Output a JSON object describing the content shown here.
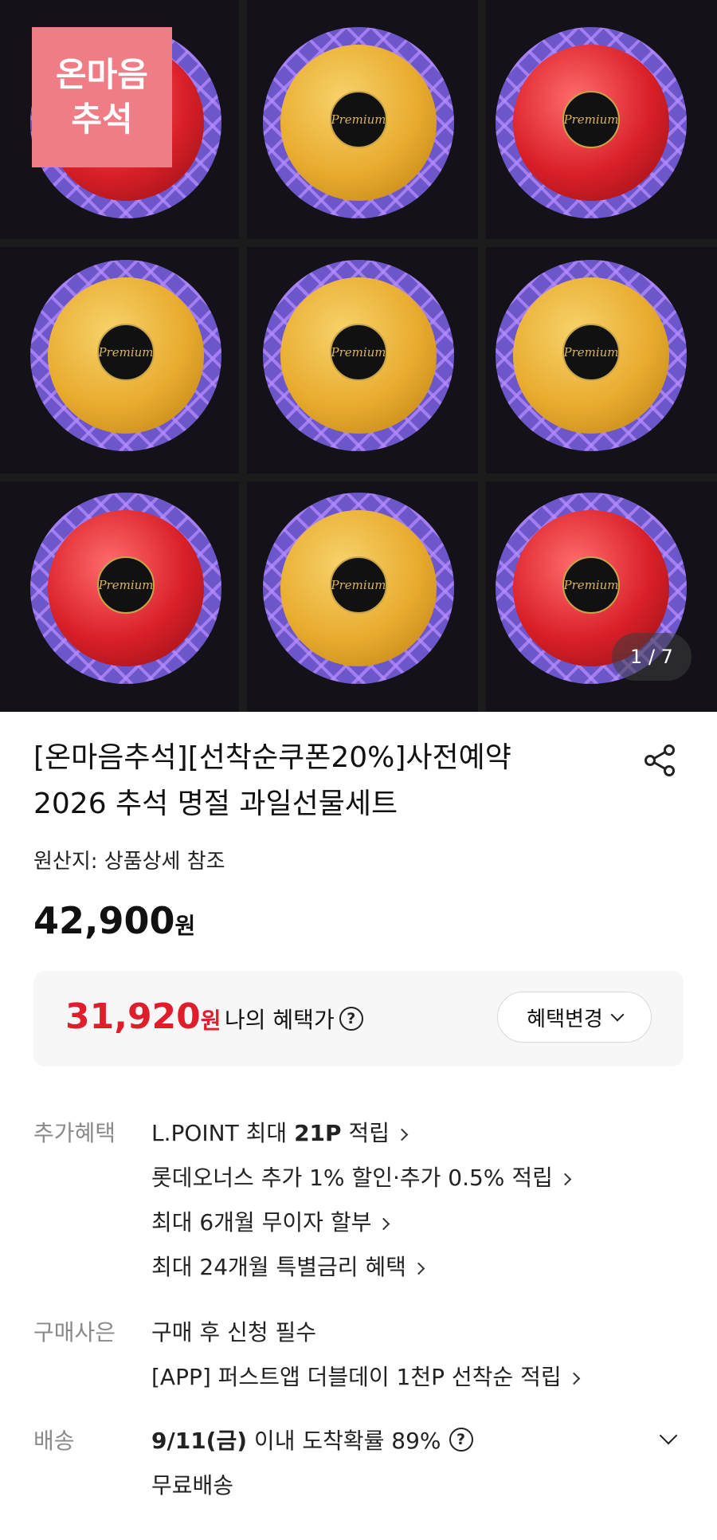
{
  "hero": {
    "badge_line1": "온마음",
    "badge_line2": "추석",
    "seal_text": "Premium",
    "counter": "1 / 7",
    "fruit_grid": [
      [
        "apple",
        "pear",
        "apple"
      ],
      [
        "pear",
        "pear",
        "pear"
      ],
      [
        "apple",
        "pear",
        "apple"
      ]
    ]
  },
  "product": {
    "title_line1": "[온마음추석][선착순쿠폰20%]사전예약",
    "title_line2": "2026 추석 명절 과일선물세트",
    "origin": "원산지: 상품상세 참조",
    "price_value": "42,900",
    "price_unit": "원"
  },
  "benefit": {
    "price_value": "31,920",
    "price_unit": "원",
    "label": "나의 혜택가",
    "change_button": "혜택변경"
  },
  "extra_benefits": {
    "label": "추가혜택",
    "items": [
      {
        "prefix": "L.POINT 최대 ",
        "bold": "21P",
        "suffix": " 적립"
      },
      {
        "prefix": "롯데오너스 추가 1% 할인·추가 0.5% 적립",
        "bold": "",
        "suffix": ""
      },
      {
        "prefix": "최대 6개월 무이자 할부",
        "bold": "",
        "suffix": ""
      },
      {
        "prefix": "최대 24개월 특별금리 혜택",
        "bold": "",
        "suffix": ""
      }
    ]
  },
  "purchase_gift": {
    "label": "구매사은",
    "line1": "구매 후 신청 필수",
    "line2": "[APP] 퍼스트앱 더블데이 1천P 선착순 적립"
  },
  "delivery": {
    "label": "배송",
    "date": "9/11(금)",
    "probability": " 이내 도착확률 89%",
    "fee": "무료배송"
  },
  "colors": {
    "accent_red": "#e01e2b",
    "badge_pink": "#f07c86",
    "muted_gray": "#8a8a8a"
  }
}
